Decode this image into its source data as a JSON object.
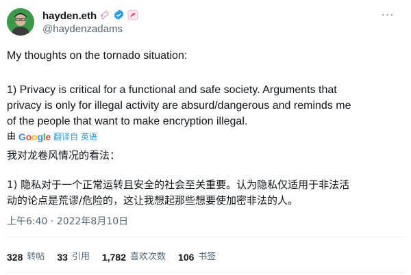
{
  "author": {
    "display_name": "hayden.eth",
    "handle": "@haydenzadams",
    "verified_color": "#1d9bf0"
  },
  "tweet": {
    "line_heading": "My thoughts on the tornado situation:",
    "paragraph_1": "1) Privacy is critical for a functional and safe society. Arguments that\nprivacy is only for illegal activity are absurd/dangerous and reminds me\nof the people that want to make encryption illegal.",
    "translated_prefix": "由",
    "translated_provider": "Google",
    "translated_note": "翻译自 英语",
    "zh_heading": "我对龙卷风情况的看法：",
    "zh_paragraph_1": "1) 隐私对于一个正常运转且安全的社会至关重要。认为隐私仅适用于非法活\n动的论点是荒谬/危险的，这让我想起那些想要使加密非法的人。",
    "timestamp": "上午6:40 · 2022年8月10日"
  },
  "stats": [
    {
      "num": "328",
      "label": "转帖"
    },
    {
      "num": "33",
      "label": "引用"
    },
    {
      "num": "1,782",
      "label": "喜欢次数"
    },
    {
      "num": "106",
      "label": "书签"
    }
  ],
  "more_label": "···",
  "colors": {
    "text": "#0f1419",
    "muted": "#536471",
    "accent": "#1d9bf0",
    "divider": "#eff3f4"
  }
}
